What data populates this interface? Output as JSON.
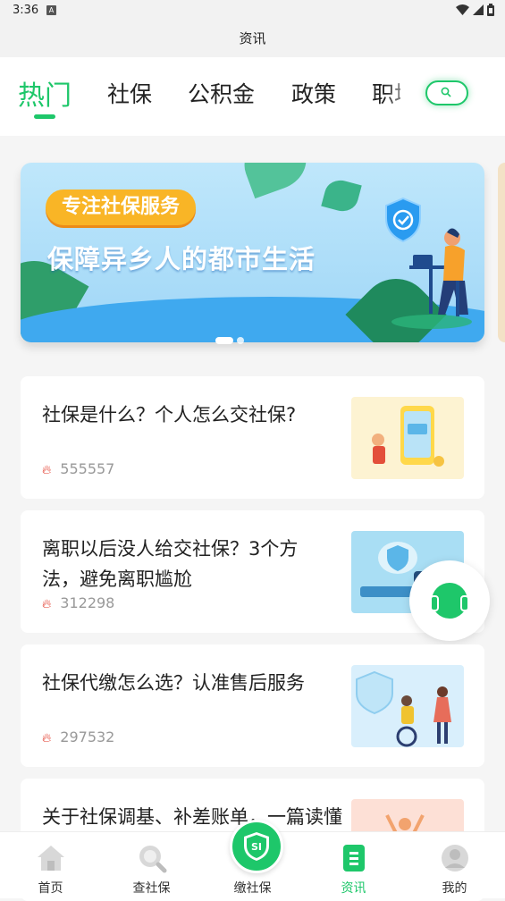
{
  "status_bar": {
    "time": "3:36",
    "notif_badge": "A"
  },
  "title": "资讯",
  "tabs": [
    {
      "label": "热门",
      "active": true
    },
    {
      "label": "社保",
      "active": false
    },
    {
      "label": "公积金",
      "active": false
    },
    {
      "label": "政策",
      "active": false
    },
    {
      "label": "职场",
      "active": false
    }
  ],
  "banner": {
    "tag": "专注社保服务",
    "slogan": "保障异乡人的都市生活",
    "page_count": 2,
    "current_page": 1
  },
  "articles": [
    {
      "title": "社保是什么？个人怎么交社保?",
      "views": "555557",
      "thumb_icon": "phone-wallet-illustration"
    },
    {
      "title": "离职以后没人给交社保？3个方法，避免离职尴尬",
      "views": "312298",
      "thumb_icon": "shield-umbrella-illustration"
    },
    {
      "title": "社保代缴怎么选？认准售后服务",
      "views": "297532",
      "thumb_icon": "elderly-care-illustration"
    },
    {
      "title": "关于社保调基、补差账单，一篇读懂",
      "views": "",
      "thumb_icon": "people-cheering-illustration"
    }
  ],
  "nav": [
    {
      "label": "首页",
      "icon": "home-icon",
      "active": false
    },
    {
      "label": "查社保",
      "icon": "search-icon",
      "active": false
    },
    {
      "label": "缴社保",
      "icon": "si-badge-icon",
      "active": false,
      "badge_text": "SI"
    },
    {
      "label": "资讯",
      "icon": "news-icon",
      "active": true
    },
    {
      "label": "我的",
      "icon": "profile-icon",
      "active": false
    }
  ],
  "colors": {
    "accent": "#1ec76a",
    "flame": "#e23b2c",
    "banner_tag": "#f9b526"
  }
}
